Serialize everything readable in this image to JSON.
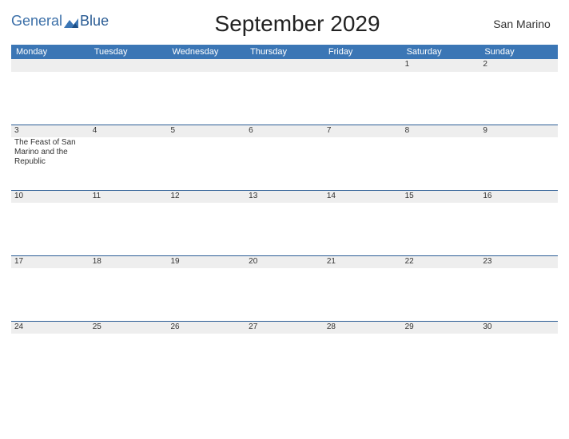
{
  "logo": {
    "general": "General",
    "blue": "Blue"
  },
  "title": "September 2029",
  "location": "San Marino",
  "colors": {
    "accent": "#3b76b5",
    "rule": "#2a5c94",
    "stripe": "#eeeeee"
  },
  "weekdays": [
    "Monday",
    "Tuesday",
    "Wednesday",
    "Thursday",
    "Friday",
    "Saturday",
    "Sunday"
  ],
  "weeks": [
    {
      "nums": [
        "",
        "",
        "",
        "",
        "",
        "1",
        "2"
      ],
      "events": [
        "",
        "",
        "",
        "",
        "",
        "",
        ""
      ]
    },
    {
      "nums": [
        "3",
        "4",
        "5",
        "6",
        "7",
        "8",
        "9"
      ],
      "events": [
        "The Feast of San Marino and the Republic",
        "",
        "",
        "",
        "",
        "",
        ""
      ]
    },
    {
      "nums": [
        "10",
        "11",
        "12",
        "13",
        "14",
        "15",
        "16"
      ],
      "events": [
        "",
        "",
        "",
        "",
        "",
        "",
        ""
      ]
    },
    {
      "nums": [
        "17",
        "18",
        "19",
        "20",
        "21",
        "22",
        "23"
      ],
      "events": [
        "",
        "",
        "",
        "",
        "",
        "",
        ""
      ]
    },
    {
      "nums": [
        "24",
        "25",
        "26",
        "27",
        "28",
        "29",
        "30"
      ],
      "events": [
        "",
        "",
        "",
        "",
        "",
        "",
        ""
      ]
    }
  ]
}
